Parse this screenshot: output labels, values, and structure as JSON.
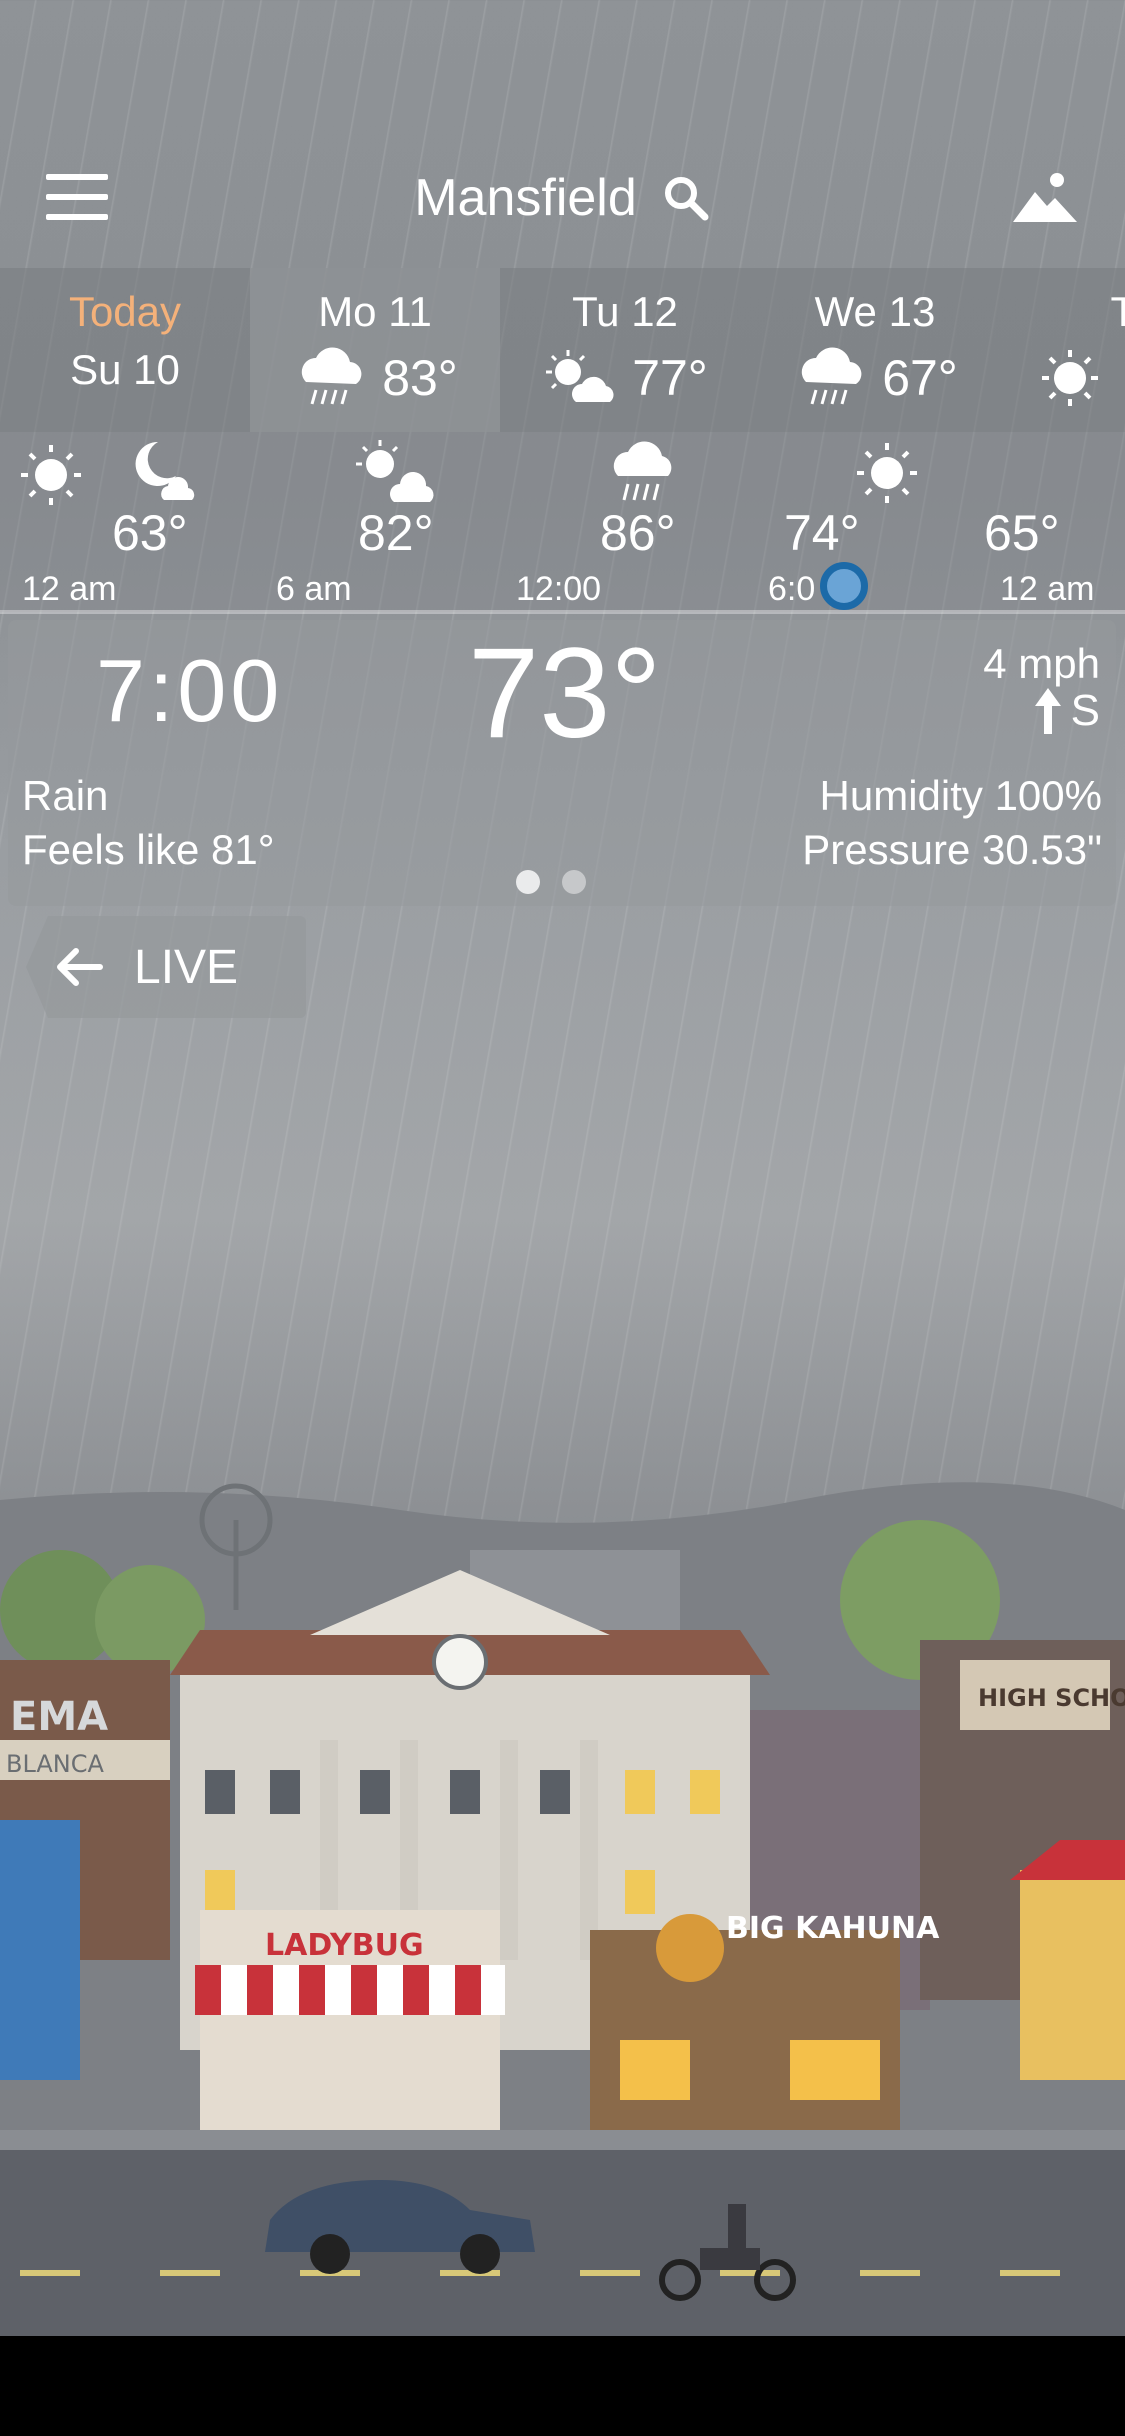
{
  "header": {
    "city": "Mansfield"
  },
  "days": [
    {
      "name": "Today",
      "sub": "Su 10"
    },
    {
      "name": "Mo 11",
      "temp": "83°",
      "icon": "rain-cloud-icon"
    },
    {
      "name": "Tu 12",
      "temp": "77°",
      "icon": "sun-cloud-icon"
    },
    {
      "name": "We 13",
      "temp": "67°",
      "icon": "rain-cloud-icon"
    },
    {
      "name": "Th",
      "icon": "sun-icon"
    }
  ],
  "hourly": {
    "temps": [
      "63°",
      "82°",
      "86°",
      "74°",
      "65°"
    ],
    "times": [
      "12 am",
      "6 am",
      "12:00",
      "6:0",
      "12 am"
    ]
  },
  "detail": {
    "time": "7:00",
    "temp": "73°",
    "wind_speed": "4 mph",
    "wind_dir": "S",
    "condition": "Rain",
    "feels_like": "Feels like 81°",
    "humidity": "Humidity 100%",
    "pressure": "Pressure 30.53\""
  },
  "live_button": {
    "label": "LIVE"
  },
  "scene": {
    "signs": [
      "LADYBUG",
      "BIG KAHUNA",
      "HIGH SCHOOL",
      "EMA",
      "BLANCA"
    ]
  },
  "colors": {
    "today": "#f4b17a",
    "knob": "#1c6aa8",
    "awning_red": "#c8323a"
  }
}
